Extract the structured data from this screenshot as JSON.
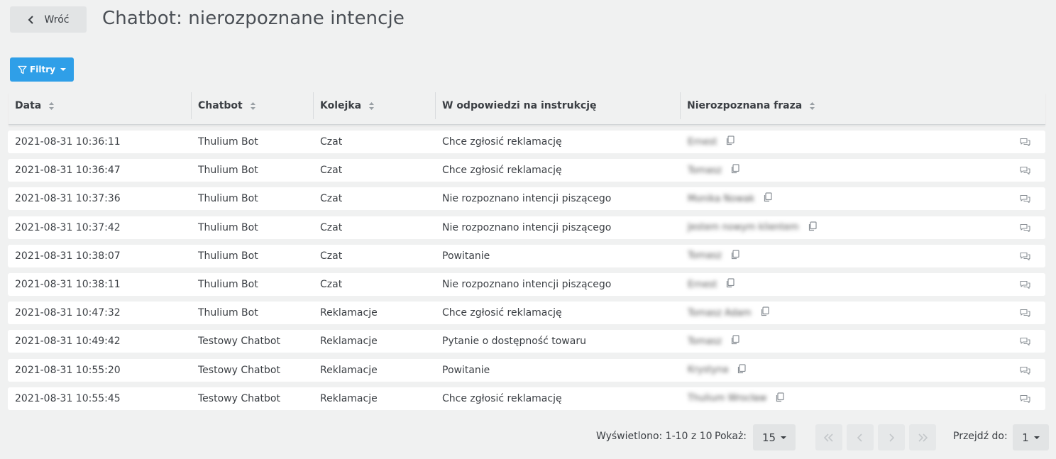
{
  "header": {
    "back_label": "Wróć",
    "title": "Chatbot: nierozpoznane intencje"
  },
  "toolbar": {
    "filter_label": "Filtry"
  },
  "table": {
    "columns": [
      "Data",
      "Chatbot",
      "Kolejka",
      "W odpowiedzi na instrukcję",
      "Nierozpoznana fraza"
    ],
    "rows": [
      {
        "date": "2021-08-31 10:36:11",
        "chatbot": "Thulium Bot",
        "queue": "Czat",
        "instruction": "Chce zgłosić reklamację",
        "phrase": "Ernest"
      },
      {
        "date": "2021-08-31 10:36:47",
        "chatbot": "Thulium Bot",
        "queue": "Czat",
        "instruction": "Chce zgłosić reklamację",
        "phrase": "Tomasz"
      },
      {
        "date": "2021-08-31 10:37:36",
        "chatbot": "Thulium Bot",
        "queue": "Czat",
        "instruction": "Nie rozpoznano intencji piszącego",
        "phrase": "Monika Nowak"
      },
      {
        "date": "2021-08-31 10:37:42",
        "chatbot": "Thulium Bot",
        "queue": "Czat",
        "instruction": "Nie rozpoznano intencji piszącego",
        "phrase": "Jestem nowym klientem"
      },
      {
        "date": "2021-08-31 10:38:07",
        "chatbot": "Thulium Bot",
        "queue": "Czat",
        "instruction": "Powitanie",
        "phrase": "Tomasz"
      },
      {
        "date": "2021-08-31 10:38:11",
        "chatbot": "Thulium Bot",
        "queue": "Czat",
        "instruction": "Nie rozpoznano intencji piszącego",
        "phrase": "Ernest"
      },
      {
        "date": "2021-08-31 10:47:32",
        "chatbot": "Thulium Bot",
        "queue": "Reklamacje",
        "instruction": "Chce zgłosić reklamację",
        "phrase": "Tomasz Adam"
      },
      {
        "date": "2021-08-31 10:49:42",
        "chatbot": "Testowy Chatbot",
        "queue": "Reklamacje",
        "instruction": "Pytanie o dostępność towaru",
        "phrase": "Tomasz"
      },
      {
        "date": "2021-08-31 10:55:20",
        "chatbot": "Testowy Chatbot",
        "queue": "Reklamacje",
        "instruction": "Powitanie",
        "phrase": "Krystyna"
      },
      {
        "date": "2021-08-31 10:55:45",
        "chatbot": "Testowy Chatbot",
        "queue": "Reklamacje",
        "instruction": "Chce zgłosić reklamację",
        "phrase": "Thulium Wrocław"
      }
    ]
  },
  "pagination": {
    "shown_text": "Wyświetlono: 1-10 z 10",
    "page_size_label": "Pokaż:",
    "page_size": "15",
    "goto_label": "Przejdź do:",
    "current_page": "1"
  }
}
